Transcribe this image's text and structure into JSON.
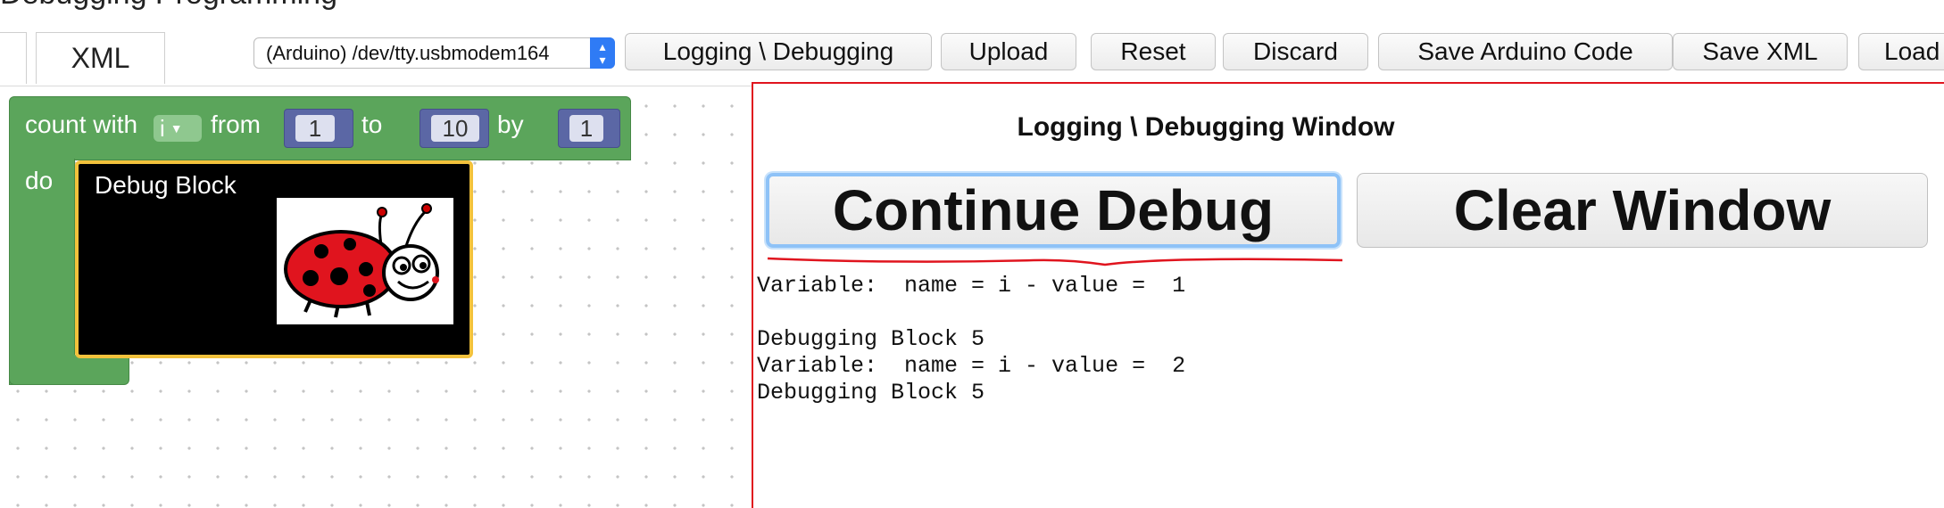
{
  "window": {
    "title_partial": "Debugging Programming"
  },
  "tabs": [
    {
      "label": ""
    },
    {
      "label": "XML"
    }
  ],
  "toolbar": {
    "port_selected": "(Arduino) /dev/tty.usbmodem164",
    "buttons": {
      "logging": "Logging \\ Debugging",
      "upload": "Upload",
      "reset": "Reset",
      "discard": "Discard",
      "save_arduino": "Save Arduino Code",
      "save_xml": "Save XML",
      "load": "Load"
    }
  },
  "workspace": {
    "loop_block": {
      "count_with": "count with",
      "variable": "i",
      "from_label": "from",
      "from_value": "1",
      "to_label": "to",
      "to_value": "10",
      "by_label": "by",
      "by_value": "1",
      "do_label": "do"
    },
    "debug_block": {
      "title": "Debug Block",
      "image_icon": "ladybug-icon"
    }
  },
  "log_window": {
    "heading": "Logging \\ Debugging Window",
    "continue_label": "Continue Debug",
    "clear_label": "Clear Window",
    "output": "Variable:  name = i - value =  1\n\nDebugging Block 5\nVariable:  name = i - value =  2\nDebugging Block 5"
  },
  "colors": {
    "loop_block": "#5ba55b",
    "number_block": "#5b67a5",
    "debug_border": "#f3c23c",
    "log_window_border": "#e0141e",
    "continue_focus": "#8ec2f7"
  }
}
